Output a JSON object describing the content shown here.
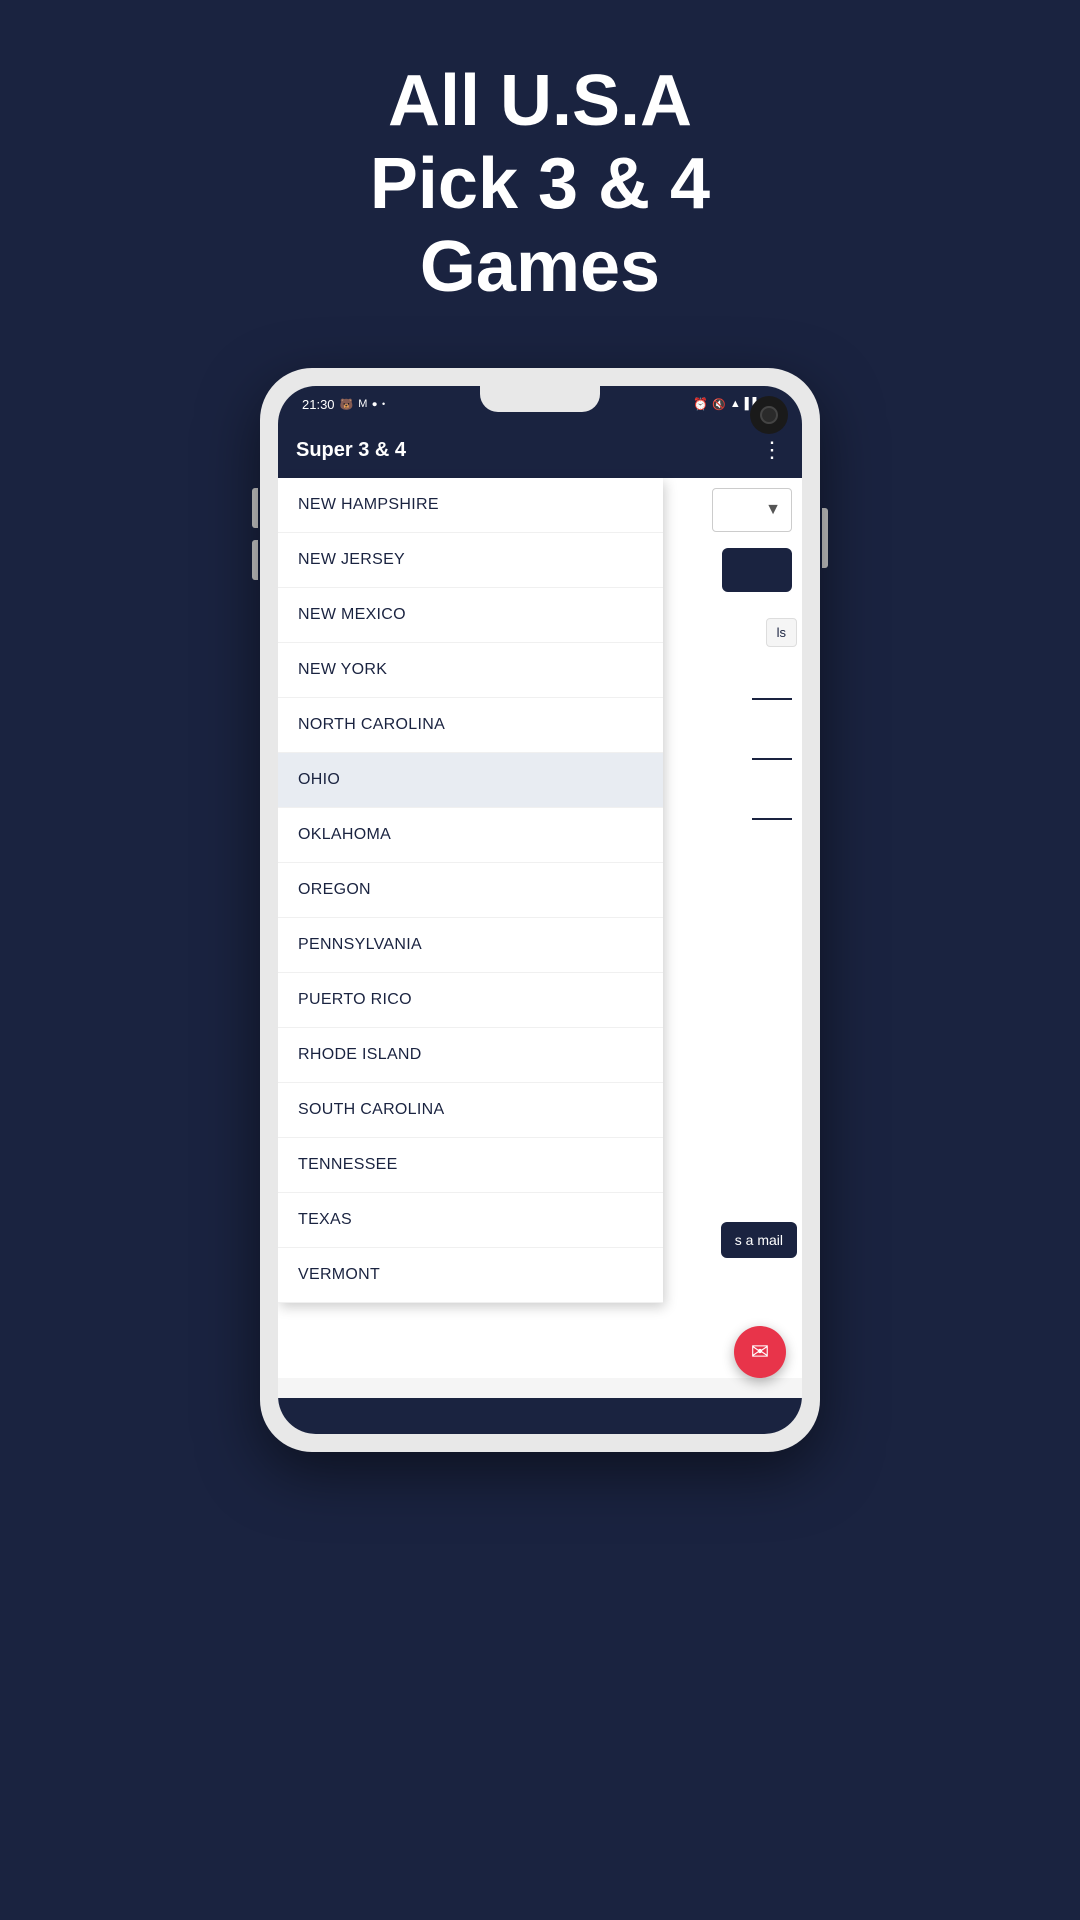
{
  "header": {
    "line1": "All U.S.A",
    "line2": "Pick 3 & 4",
    "line3": "Games"
  },
  "phone": {
    "status_bar": {
      "time": "21:30",
      "icons_left": [
        "bear-icon",
        "mail-icon",
        "record-icon",
        "dot-icon"
      ],
      "icons_right": [
        "alarm-icon",
        "mute-icon",
        "wifi-icon",
        "signal-icon",
        "battery-icon"
      ]
    },
    "app_bar": {
      "title": "Super 3 & 4",
      "menu_label": "⋮"
    }
  },
  "dropdown": {
    "items": [
      {
        "label": "NEW HAMPSHIRE"
      },
      {
        "label": "NEW JERSEY"
      },
      {
        "label": "NEW MEXICO"
      },
      {
        "label": "NEW YORK"
      },
      {
        "label": "NORTH CAROLINA"
      },
      {
        "label": "OHIO",
        "highlighted": true
      },
      {
        "label": "OKLAHOMA"
      },
      {
        "label": "OREGON"
      },
      {
        "label": "PENNSYLVANIA"
      },
      {
        "label": "PUERTO RICO"
      },
      {
        "label": "RHODE ISLAND"
      },
      {
        "label": "SOUTH CAROLINA"
      },
      {
        "label": "TENNESSEE"
      },
      {
        "label": "TEXAS"
      },
      {
        "label": "VERMONT"
      }
    ]
  },
  "bg_ui": {
    "details_label": "ls",
    "mail_label": "s a mail"
  },
  "fab": {
    "icon": "✉"
  }
}
